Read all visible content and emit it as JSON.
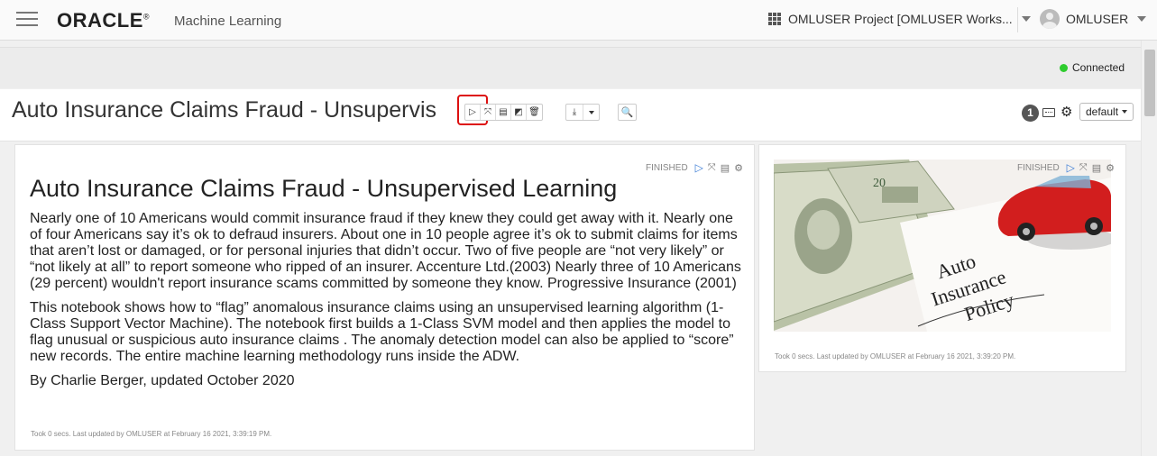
{
  "header": {
    "logo_text": "ORACLE",
    "logo_mark": "®",
    "product": "Machine Learning",
    "project": "OMLUSER Project [OMLUSER Works...",
    "user": "OMLUSER"
  },
  "status": {
    "connection": "Connected",
    "color": "#2ecc2e"
  },
  "notebook": {
    "title": "Auto Insurance Claims Fraud - Unsupervis",
    "interpreter_count": "1",
    "binding": "default"
  },
  "paragraph_left": {
    "status": "FINISHED",
    "heading": "Auto Insurance Claims Fraud - Unsupervised Learning",
    "p1": "Nearly one of 10 Americans would commit insurance fraud if they knew they could get away with it. Nearly one of four Americans say it’s ok to defraud insurers. About one in 10 people agree it’s ok to submit claims for items that aren’t lost or damaged, or for personal injuries that didn’t occur. Two of five people are “not very likely” or “not likely at all” to report someone who ripped of an insurer. Accenture Ltd.(2003) Nearly three of 10 Americans (29 percent) wouldn't report insurance scams committed by someone they know. Progressive Insurance (2001)",
    "p2": "This notebook shows how to “flag” anomalous insurance claims using an unsupervised learning algorithm (1-Class Support Vector Machine). The notebook first builds a 1-Class SVM model and then applies the model to flag unusual or suspicious auto insurance claims . The anomaly detection model can also be applied to “score” new records. The entire machine learning methodology runs inside the ADW.",
    "p3": "By Charlie Berger, updated October 2020",
    "took": "Took 0 secs. Last updated by OMLUSER at February 16 2021, 3:39:19 PM."
  },
  "paragraph_right": {
    "status": "FINISHED",
    "image_text_line1": "Auto",
    "image_text_line2": "Insurance",
    "image_text_line3": "Policy",
    "took": "Took 0 secs. Last updated by OMLUSER at February 16 2021, 3:39:20 PM."
  }
}
